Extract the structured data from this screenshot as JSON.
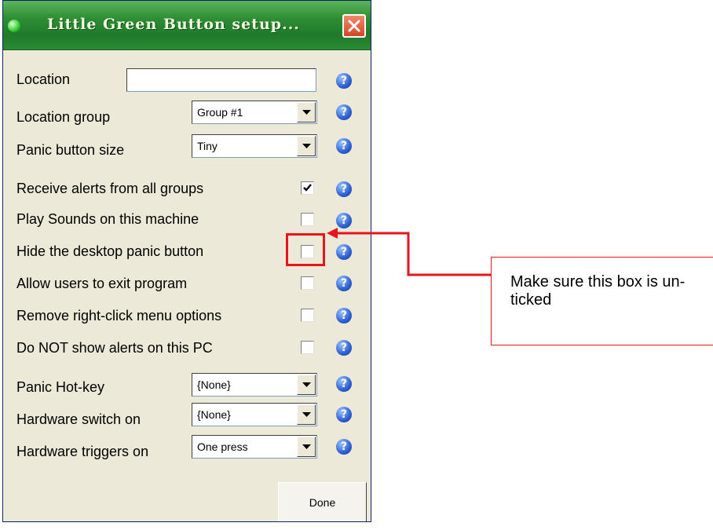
{
  "window": {
    "title": "Little Green Button setup...",
    "title_bar_color": "#2e8f35",
    "icons": {
      "app": "green-dot-icon",
      "close": "close-icon",
      "help": "help-question-icon",
      "dropdown": "chevron-down-icon"
    }
  },
  "form": {
    "location": {
      "label": "Location",
      "value": ""
    },
    "location_group": {
      "label": "Location group",
      "value": "Group #1"
    },
    "panic_button_size": {
      "label": "Panic button size",
      "value": "Tiny"
    },
    "receive_alerts": {
      "label": "Receive alerts from all groups",
      "checked": true
    },
    "play_sounds": {
      "label": "Play Sounds on this machine",
      "checked": false
    },
    "hide_panic_button": {
      "label": "Hide the desktop panic button",
      "checked": false
    },
    "allow_exit": {
      "label": "Allow users to exit program",
      "checked": false
    },
    "remove_rightclick": {
      "label": "Remove right-click menu options",
      "checked": false
    },
    "no_alerts": {
      "label": "Do NOT show alerts on this PC",
      "checked": false
    },
    "panic_hotkey": {
      "label": "Panic Hot-key",
      "value": "{None}"
    },
    "hardware_switch": {
      "label": "Hardware switch on",
      "value": "{None}"
    },
    "hardware_triggers": {
      "label": "Hardware triggers on",
      "value": "One press"
    }
  },
  "buttons": {
    "done": "Done"
  },
  "annotation": {
    "callout_text": "Make sure this box is un-ticked",
    "color": "#e8131b"
  }
}
